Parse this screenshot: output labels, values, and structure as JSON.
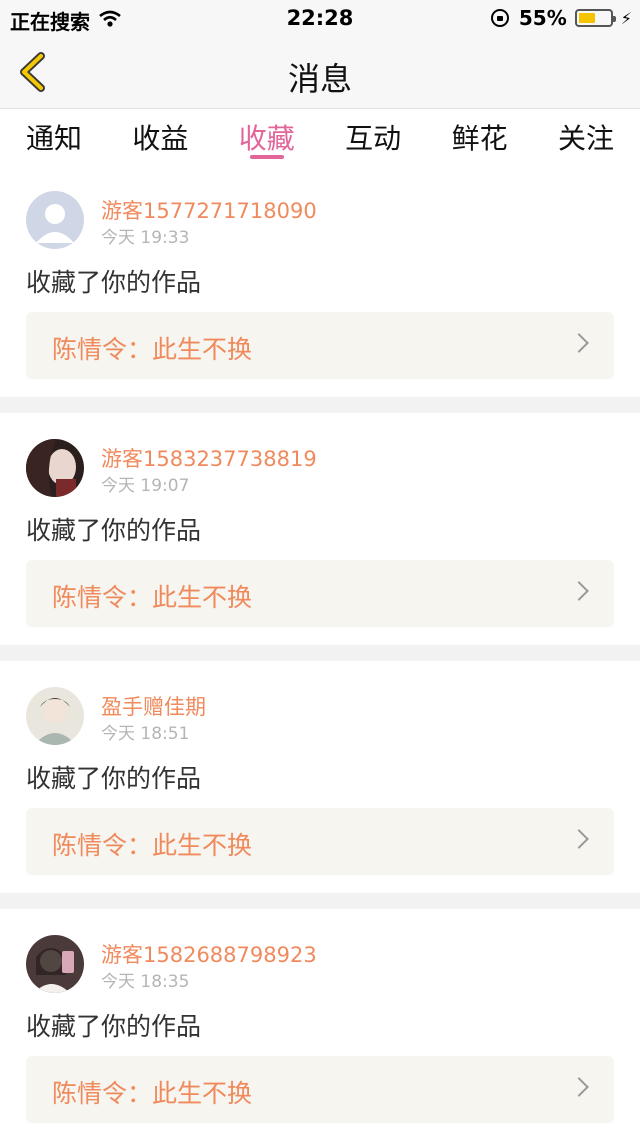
{
  "status_bar": {
    "carrier": "正在搜索",
    "time": "22:28",
    "battery": "55%",
    "battery_level": 0.55
  },
  "nav": {
    "title": "消息"
  },
  "tabs": [
    {
      "label": "通知",
      "active": false
    },
    {
      "label": "收益",
      "active": false
    },
    {
      "label": "收藏",
      "active": true
    },
    {
      "label": "互动",
      "active": false
    },
    {
      "label": "鲜花",
      "active": false
    },
    {
      "label": "关注",
      "active": false
    }
  ],
  "colors": {
    "accent_pink": "#e2669a",
    "name_orange": "#f08a5d",
    "card_bg": "#f6f5ef"
  },
  "items": [
    {
      "username": "游客1577271718090",
      "time": "今天 19:33",
      "action": "收藏了你的作品",
      "work": "陈情令：此生不换",
      "avatar": "default-avatar-icon"
    },
    {
      "username": "游客1583237738819",
      "time": "今天 19:07",
      "action": "收藏了你的作品",
      "work": "陈情令：此生不换",
      "avatar": "user-photo"
    },
    {
      "username": "盈手赠佳期",
      "time": "今天 18:51",
      "action": "收藏了你的作品",
      "work": "陈情令：此生不换",
      "avatar": "user-photo"
    },
    {
      "username": "游客1582688798923",
      "time": "今天 18:35",
      "action": "收藏了你的作品",
      "work": "陈情令：此生不换",
      "avatar": "user-photo"
    }
  ]
}
